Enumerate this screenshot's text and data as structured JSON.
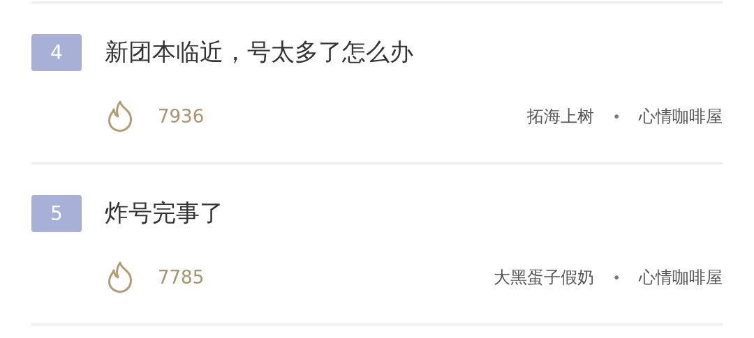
{
  "posts": [
    {
      "rank": "4",
      "title": "新团本临近，号太多了怎么办",
      "heat": "7936",
      "author": "拓海上树",
      "separator": "•",
      "forum": "心情咖啡屋"
    },
    {
      "rank": "5",
      "title": "炸号完事了",
      "heat": "7785",
      "author": "大黑蛋子假奶",
      "separator": "•",
      "forum": "心情咖啡屋"
    }
  ]
}
